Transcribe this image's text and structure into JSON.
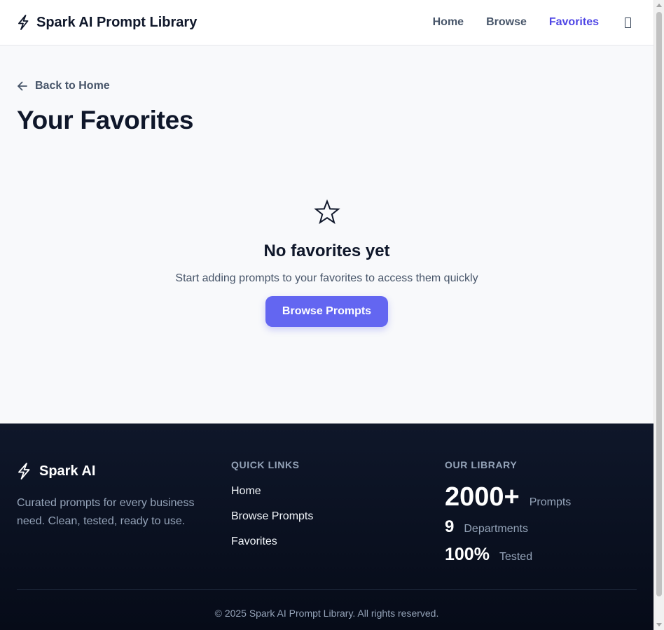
{
  "header": {
    "brand_name": "Spark AI Prompt Library",
    "nav": {
      "home": "Home",
      "browse": "Browse",
      "favorites": "Favorites"
    },
    "active_nav": "Favorites"
  },
  "main": {
    "back_link": "Back to Home",
    "page_title": "Your Favorites",
    "empty_state": {
      "icon": "star-outline-icon",
      "title": "No favorites yet",
      "subtitle": "Start adding prompts to your favorites to access them quickly",
      "button_label": "Browse Prompts"
    }
  },
  "footer": {
    "brand_name": "Spark AI",
    "description": "Curated prompts for every business need. Clean, tested, ready to use.",
    "quick_links": {
      "heading": "QUICK LINKS",
      "items": [
        "Home",
        "Browse Prompts",
        "Favorites"
      ]
    },
    "library": {
      "heading": "OUR LIBRARY",
      "stats": [
        {
          "value": "2000+",
          "label": "Prompts"
        },
        {
          "value": "9",
          "label": "Departments"
        },
        {
          "value": "100%",
          "label": "Tested"
        }
      ]
    },
    "copyright": "© 2025 Spark AI Prompt Library. All rights reserved."
  },
  "colors": {
    "accent": "#4f46e5",
    "button": "#6366f1",
    "footer_bg": "#0f172a",
    "page_bg": "#f8f9fb"
  }
}
